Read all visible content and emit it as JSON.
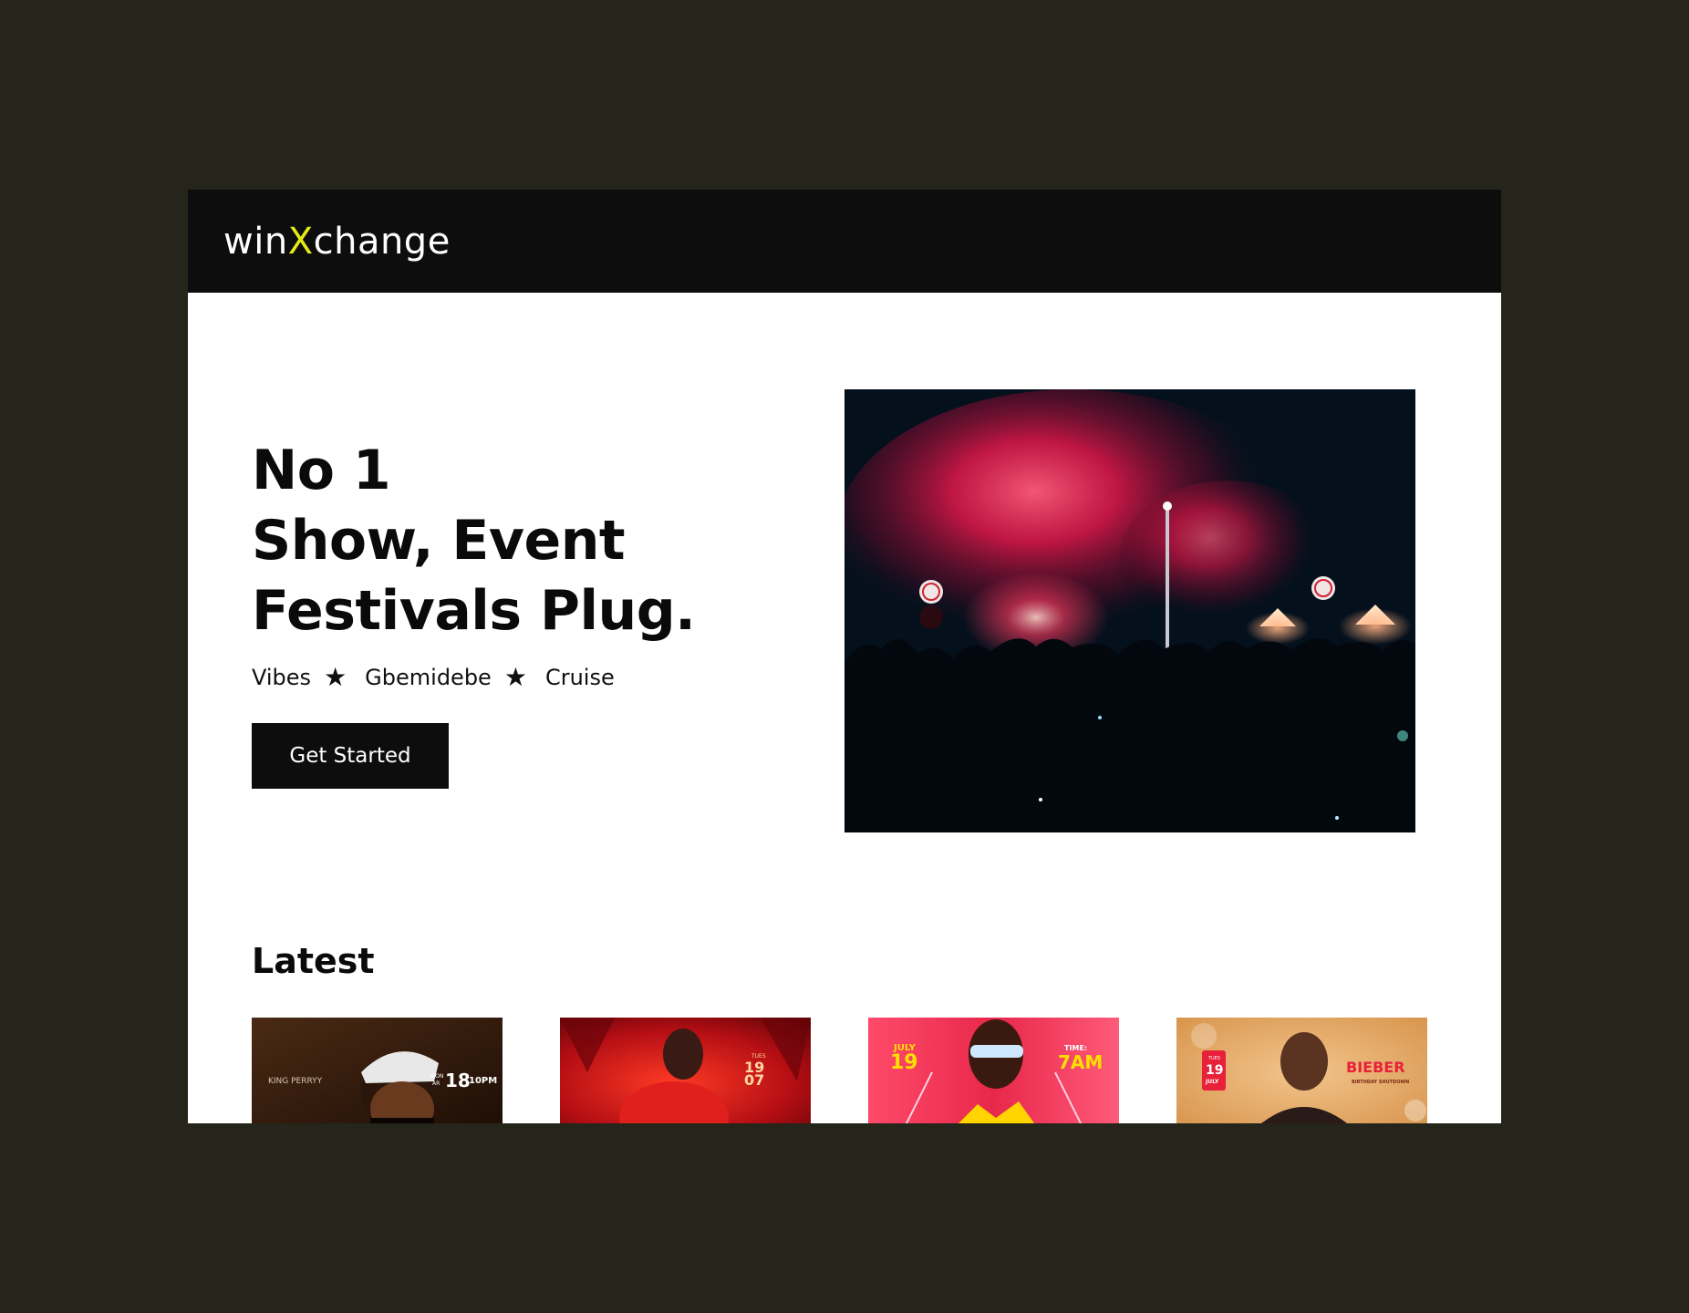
{
  "brand": {
    "prefix": "win",
    "highlight": "X",
    "suffix": "change"
  },
  "hero": {
    "title_lines": [
      "No 1",
      "Show, Event",
      "Festivals Plug."
    ],
    "tags": [
      "Vibes",
      "Gbemidebe",
      "Cruise"
    ],
    "separator": "★",
    "cta_label": "Get Started"
  },
  "latest": {
    "heading": "Latest",
    "cards": [
      {
        "name": "KING PERRYY",
        "day": "MON",
        "month": "AR",
        "date": "18",
        "time": "10PM"
      },
      {
        "day": "TUES",
        "date": "19",
        "month": "07"
      },
      {
        "month": "JULY",
        "date": "19",
        "time_label": "TIME:",
        "time": "7AM"
      },
      {
        "day": "TUES",
        "date": "19",
        "month": "JULY",
        "title": "BIEBER",
        "subtitle": "BIRTHDAY SHUTDOWN"
      }
    ]
  },
  "colors": {
    "accent": "#e6ea16",
    "nav": "#0d0d0d",
    "page_bg": "#25251b"
  }
}
